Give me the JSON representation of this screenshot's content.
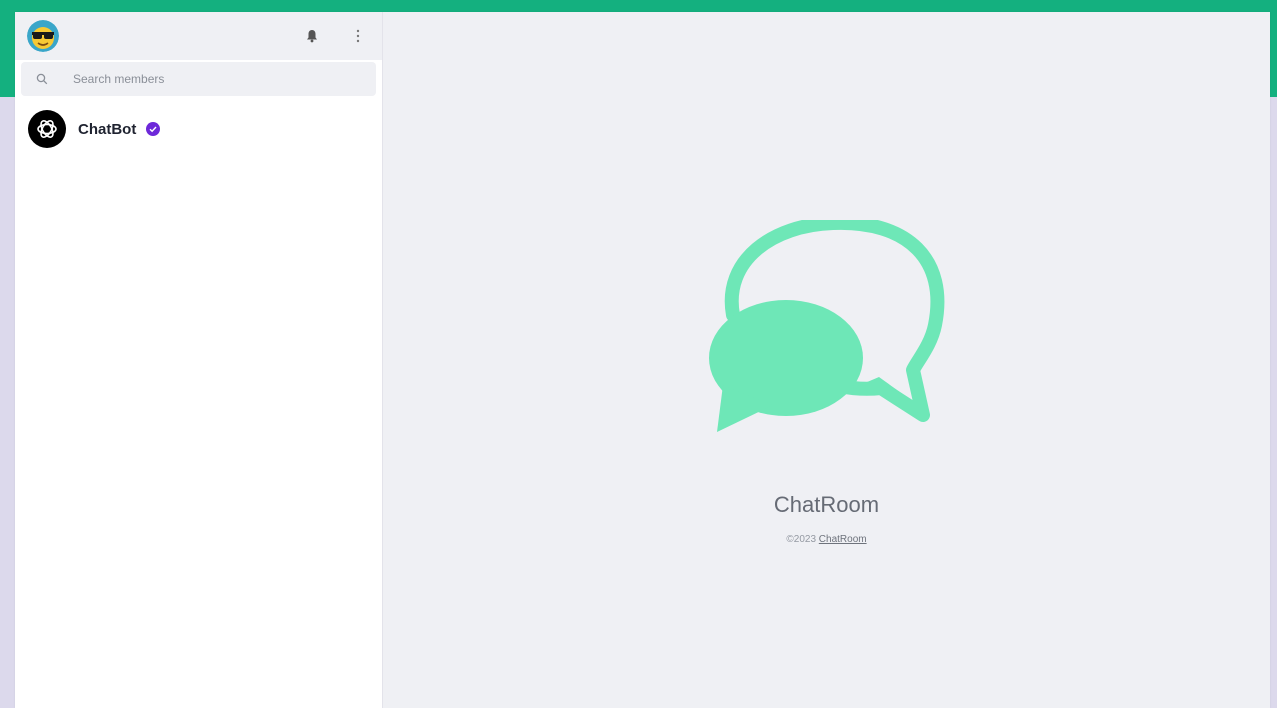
{
  "sidebar": {
    "header": {
      "avatar": "sunglasses-emoji-avatar",
      "icons": [
        "bell-icon",
        "more-vertical-icon"
      ]
    },
    "search": {
      "placeholder": "Search members"
    },
    "contacts": [
      {
        "name": "ChatBot",
        "avatar": "openai-logo",
        "verified": true
      }
    ]
  },
  "main": {
    "title": "ChatRoom",
    "copyright_prefix": "©2023",
    "copyright_link": "ChatRoom"
  },
  "colors": {
    "brand_green": "#14b07f",
    "logo_green": "#6ee7b7",
    "verified_purple": "#6d28d9",
    "panel_bg": "#eff0f4"
  }
}
